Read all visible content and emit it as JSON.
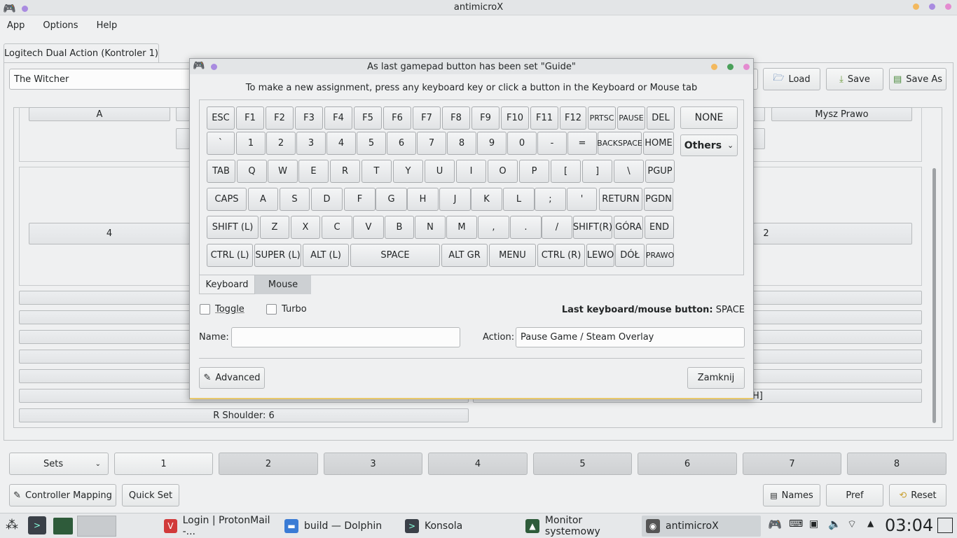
{
  "window": {
    "title": "antimicroX"
  },
  "menubar": {
    "items": [
      "App",
      "Options",
      "Help"
    ]
  },
  "controller_tab": "Logitech Dual Action (Kontroler 1)",
  "profile": {
    "selected": "The Witcher",
    "load": "Load",
    "save": "Save",
    "save_as": "Save As"
  },
  "background": {
    "btn_a": "A",
    "btn_mysz_prawo": "Mysz Prawo",
    "btn_4": "4",
    "btn_2": "2",
    "r_shoulder": "R Shoulder: 6",
    "partial_h": "H]"
  },
  "sets": {
    "label": "Sets",
    "items": [
      "1",
      "2",
      "3",
      "4",
      "5",
      "6",
      "7",
      "8"
    ]
  },
  "bottom": {
    "controller_mapping": "Controller Mapping",
    "quick_set": "Quick Set",
    "names": "Names",
    "pref": "Pref",
    "reset": "Reset"
  },
  "dialog": {
    "title": "As last gamepad button has been set \"Guide\"",
    "instruction": "To make a new assignment, press any keyboard key or click a button in the Keyboard or Mouse tab",
    "none": "NONE",
    "others": "Others",
    "rows": [
      [
        "ESC",
        "F1",
        "F2",
        "F3",
        "F4",
        "F5",
        "F6",
        "F7",
        "F8",
        "F9",
        "F10",
        "F11",
        "F12",
        "PRTSC",
        "PAUSE",
        "DEL"
      ],
      [
        "`",
        "1",
        "2",
        "3",
        "4",
        "5",
        "6",
        "7",
        "8",
        "9",
        "0",
        "-",
        "=",
        "BACKSPACE",
        "HOME"
      ],
      [
        "TAB",
        "Q",
        "W",
        "E",
        "R",
        "T",
        "Y",
        "U",
        "I",
        "O",
        "P",
        "[",
        "]",
        "\\",
        "PGUP"
      ],
      [
        "CAPS",
        "A",
        "S",
        "D",
        "F",
        "G",
        "H",
        "J",
        "K",
        "L",
        ";",
        "'",
        "RETURN",
        "PGDN"
      ],
      [
        "SHIFT (L)",
        "Z",
        "X",
        "C",
        "V",
        "B",
        "N",
        "M",
        ",",
        ".",
        "/",
        "SHIFT(R)",
        "GÓRA",
        "END"
      ],
      [
        "CTRL (L)",
        "SUPER (L)",
        "ALT (L)",
        "SPACE",
        "ALT GR",
        "MENU",
        "CTRL (R)",
        "LEWO",
        "DÓŁ",
        "PRAWO"
      ]
    ],
    "tabs": [
      "Keyboard",
      "Mouse"
    ],
    "toggle": "Toggle",
    "turbo": "Turbo",
    "last_label": "Last keyboard/mouse button:",
    "last_value": "SPACE",
    "name_label": "Name:",
    "name_value": "",
    "action_label": "Action:",
    "action_value": "Pause Game / Steam Overlay",
    "advanced": "Advanced",
    "close": "Zamknij"
  },
  "taskbar": {
    "tasks": [
      "Login | ProtonMail -...",
      "build — Dolphin",
      "Konsola",
      "Monitor systemowy",
      "antimicroX"
    ],
    "clock": "03:04"
  }
}
